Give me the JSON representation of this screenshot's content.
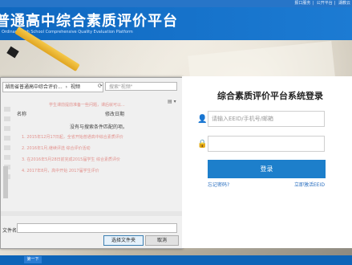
{
  "topbar": {
    "links": [
      "报口服务",
      "公开平台",
      "湖教云"
    ]
  },
  "header": {
    "title": "普通高中综合素质评价平台",
    "subtitle": "Ordinary High School Comprehensive Quality Evaluation Platform"
  },
  "file_dialog": {
    "address": [
      "湖南省普通高中综合评价...",
      "视频"
    ],
    "search_placeholder": "搜索\"视频\"",
    "column_name": "名称",
    "column_date": "修改日期",
    "empty_message": "没有与搜索条件匹配的项。",
    "filename_label": "文件名:",
    "open_button": "选择文件夹",
    "cancel_button": "取消"
  },
  "background_text": [
    "学生课前提前准备一些问题，课后就可以...",
    "1. 2015年12月17日起，全省开始普通高中综合素质评价",
    "2. 2016年1月,继续评选 综合评价活动",
    "3. 在2016年5月28日前完成2015届学生 综合素质评价",
    "4. 2017年8月，高中开始 2017届学生评价"
  ],
  "login": {
    "title": "综合素质评价平台系统登录",
    "username_placeholder": "请输入EEID/手机号/邮箱",
    "password_placeholder": "",
    "submit_label": "登录",
    "forgot_link": "忘记密码?",
    "activate_link": "立即激活EEID"
  },
  "footer": {
    "button_label": "第一下"
  },
  "colors": {
    "header_blue": "#1c7bd3",
    "login_button": "#1d7fcb",
    "footer_blue": "#0d64b8"
  }
}
